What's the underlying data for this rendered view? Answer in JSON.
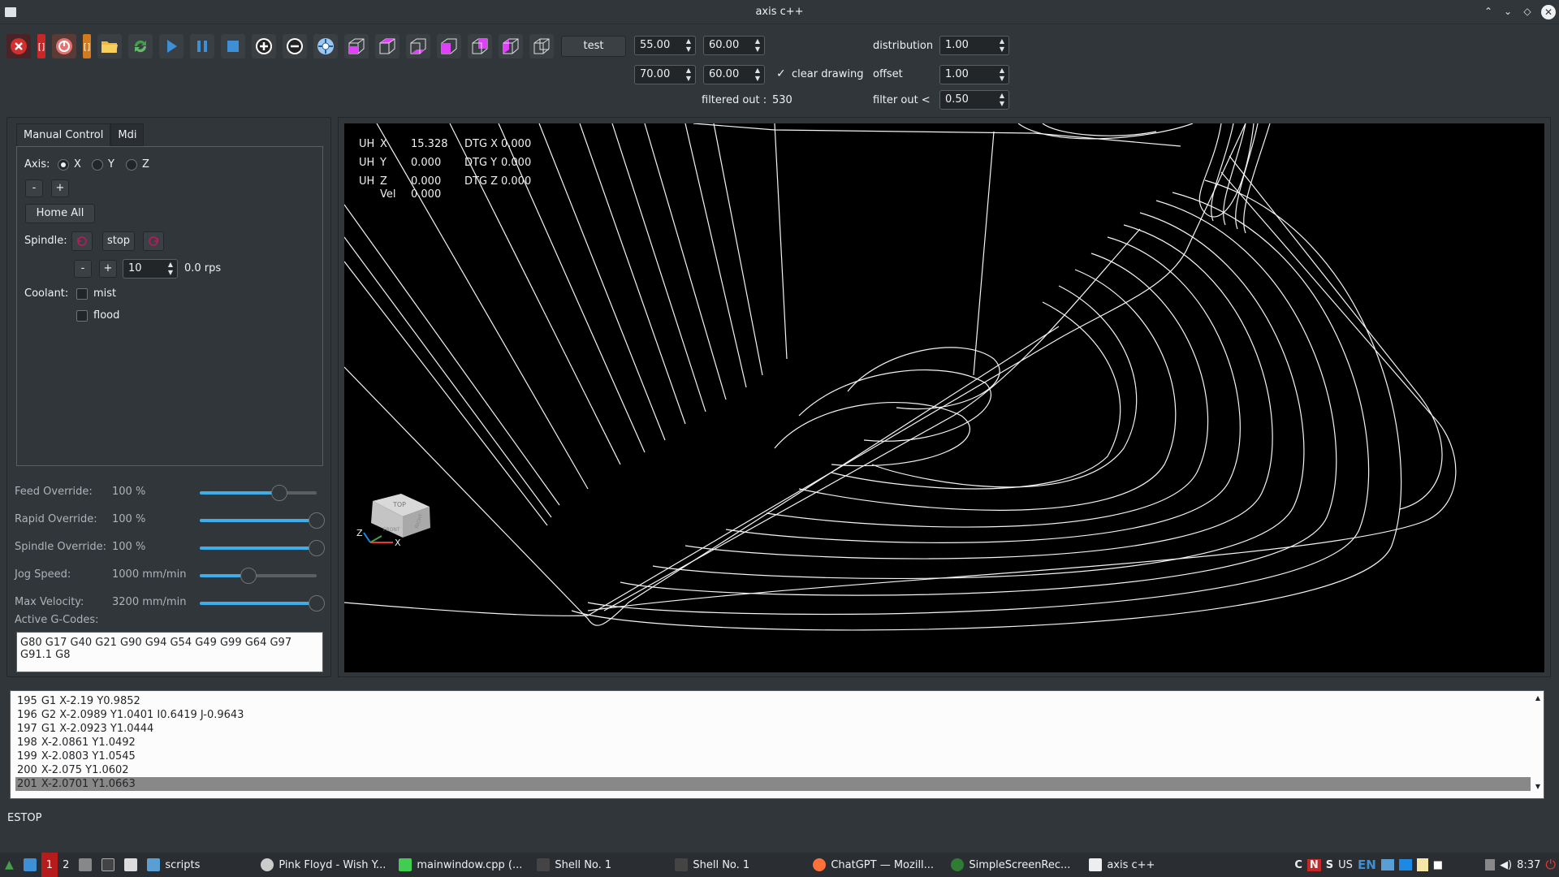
{
  "window": {
    "title": "axis c++"
  },
  "toolbar": {
    "test_label": "test",
    "spin1": "55.00",
    "spin2": "60.00",
    "spin3": "70.00",
    "spin4": "60.00",
    "clear_drawing_label": "clear drawing",
    "clear_drawing_checked": true,
    "distribution_label": "distribution",
    "distribution_value": "1.00",
    "offset_label": "offset",
    "offset_value": "1.00",
    "filtered_out_label": "filtered out :",
    "filtered_out_value": "530",
    "filter_out_label": "filter out <",
    "filter_out_value": "0.50"
  },
  "tabs": {
    "manual": "Manual Control",
    "mdi": "Mdi"
  },
  "manual": {
    "axis_label": "Axis:",
    "axis_options": [
      "X",
      "Y",
      "Z"
    ],
    "axis_selected": "X",
    "minus": "-",
    "plus": "+",
    "home_all": "Home All",
    "spindle_label": "Spindle:",
    "spindle_stop": "stop",
    "spindle_speed": "10",
    "spindle_rps": "0.0 rps",
    "coolant_label": "Coolant:",
    "mist": "mist",
    "flood": "flood"
  },
  "overrides": [
    {
      "label": "Feed Override:",
      "value": "100 %",
      "level": 0.68
    },
    {
      "label": "Rapid Override:",
      "value": "100 %",
      "level": 1.0
    },
    {
      "label": "Spindle Override:",
      "value": "100 %",
      "level": 1.0
    },
    {
      "label": "Jog Speed:",
      "value": "1000 mm/min",
      "level": 0.42
    },
    {
      "label": "Max Velocity:",
      "value": "3200 mm/min",
      "level": 1.0
    }
  ],
  "gcodes": {
    "label": "Active G-Codes:",
    "value": "G80 G17 G40 G21 G90 G94 G54 G49 G99 G64 G97 G91.1 G8"
  },
  "dro": {
    "rows": [
      {
        "home": "UH",
        "axis": "X",
        "value": "15.328",
        "dtg_label": "DTG X",
        "dtg": "0.000"
      },
      {
        "home": "UH",
        "axis": "Y",
        "value": "0.000",
        "dtg_label": "DTG Y",
        "dtg": "0.000"
      },
      {
        "home": "UH",
        "axis": "Z",
        "value": "0.000",
        "dtg_label": "DTG Z",
        "dtg": "0.000"
      }
    ],
    "vel_label": "Vel",
    "vel_value": "0.000",
    "cube_top": "TOP",
    "cube_right": "RIGHT",
    "cube_front": "FRONT",
    "axis_z": "Z",
    "axis_x": "X"
  },
  "code_lines": [
    {
      "num": "195",
      "text": "G1 X-2.19 Y0.9852"
    },
    {
      "num": "196",
      "text": "G2 X-2.0989 Y1.0401 I0.6419 J-0.9643"
    },
    {
      "num": "197",
      "text": "G1 X-2.0923 Y1.0444"
    },
    {
      "num": "198",
      "text": "X-2.0861 Y1.0492"
    },
    {
      "num": "199",
      "text": "X-2.0803 Y1.0545"
    },
    {
      "num": "200",
      "text": "X-2.075 Y1.0602"
    },
    {
      "num": "201",
      "text": "X-2.0701 Y1.0663"
    }
  ],
  "status": "ESTOP",
  "taskbar": {
    "workspace": "1",
    "workspace2": "2",
    "items": [
      {
        "label": "scripts",
        "icon": "folder-icon"
      },
      {
        "label": "Pink Floyd - Wish Y...",
        "icon": "music-icon"
      },
      {
        "label": "mainwindow.cpp (...",
        "icon": "qtcreator-icon"
      },
      {
        "label": "Shell No. 1",
        "icon": "terminal-icon"
      },
      {
        "label": "Shell No. 1",
        "icon": "terminal-icon"
      },
      {
        "label": "ChatGPT — Mozill...",
        "icon": "firefox-icon"
      },
      {
        "label": "SimpleScreenRec...",
        "icon": "recorder-icon"
      },
      {
        "label": "axis c++",
        "icon": "app-icon"
      }
    ],
    "tray_c": "C",
    "tray_n": "N",
    "tray_s": "S",
    "kbd": "US",
    "lang": "EN",
    "time": "8:37"
  }
}
